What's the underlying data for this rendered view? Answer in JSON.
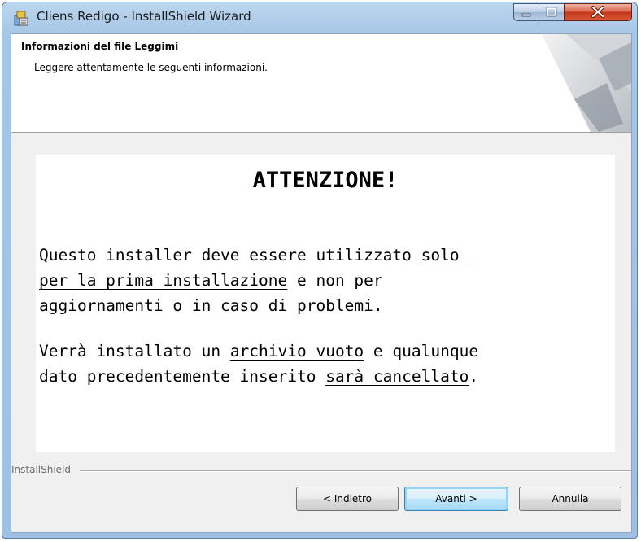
{
  "window": {
    "title": "Cliens Redigo - InstallShield Wizard",
    "controls": [
      "minimize",
      "maximize",
      "close"
    ]
  },
  "header": {
    "title": "Informazioni del file Leggimi",
    "subtitle": "Leggere attentamente le seguenti informazioni."
  },
  "notice": {
    "title": "ATTENZIONE!",
    "p1": {
      "l1a": "Questo installer deve essere utilizzato ",
      "l1b": "solo ",
      "l2a": "per la prima installazione",
      "l2b": " e non per",
      "l3": "aggiornamenti o in caso di problemi."
    },
    "p2": {
      "l1a": "Verrà installato un ",
      "l1b": "archivio vuoto",
      "l1c": " e qualunque",
      "l2a": "dato precedentemente inserito ",
      "l2b": "sarà cancellato",
      "l2c": "."
    }
  },
  "footer": {
    "brand": "InstallShield",
    "back_label": "< Indietro",
    "next_label": "Avanti >",
    "cancel_label": "Annulla"
  },
  "colors": {
    "title_bar": "#a6c6e6",
    "close_button": "#c4361a",
    "default_button_border": "#3c7fb1"
  }
}
